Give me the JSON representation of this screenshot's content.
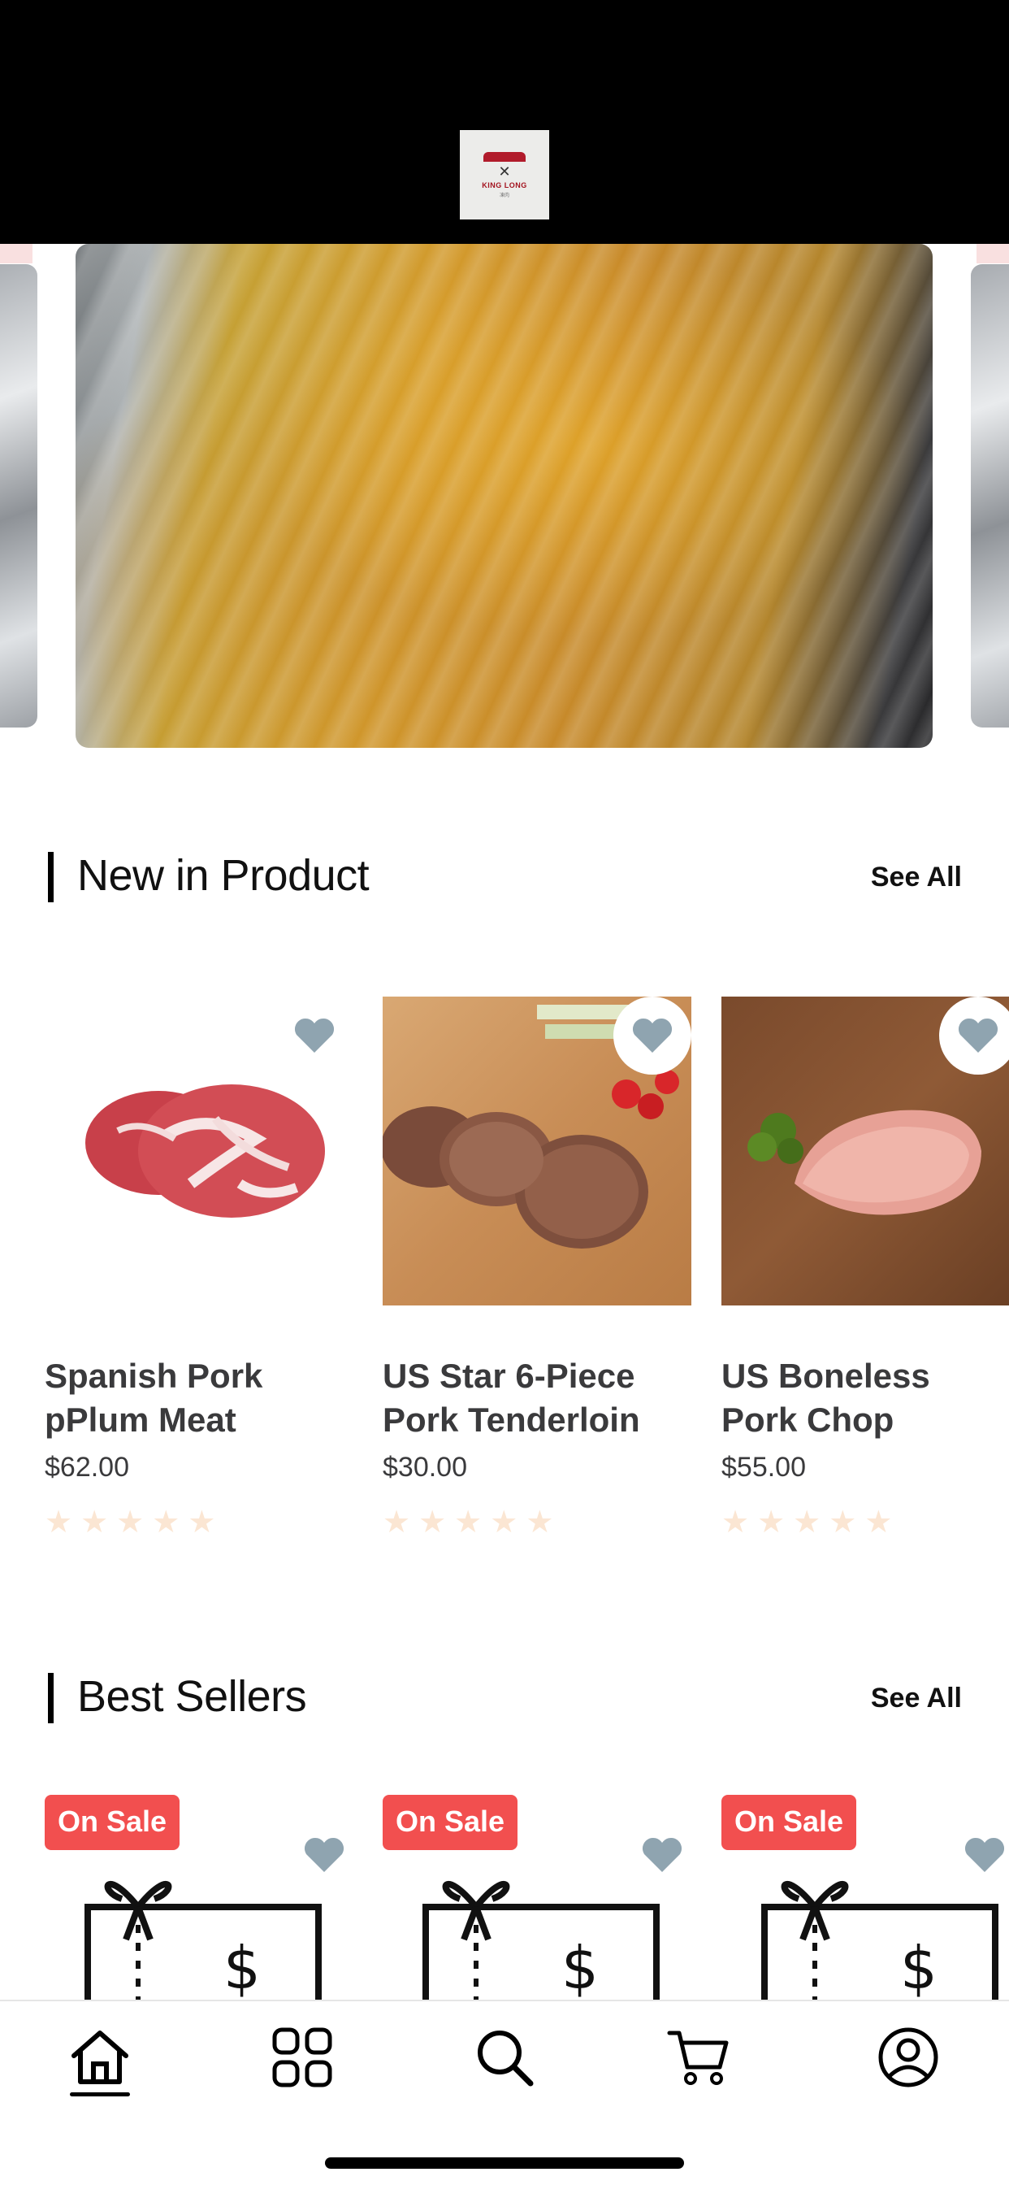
{
  "header": {
    "logo_text": "KING LONG",
    "logo_sub": "凍肉"
  },
  "carousel": {
    "active_slide": 1
  },
  "new_products": {
    "title": "New in Product",
    "see_all": "See All",
    "items": [
      {
        "name": "Spanish Pork pPlum Meat",
        "price": "$62.00",
        "rating": 0
      },
      {
        "name": "US Star 6-Piece Pork Tenderloin",
        "price": "$30.00",
        "rating": 0
      },
      {
        "name": "US Boneless Pork Chop",
        "price": "$55.00",
        "rating": 0
      }
    ]
  },
  "best_sellers": {
    "title": "Best Sellers",
    "see_all": "See All",
    "items": [
      {
        "badge": "On Sale"
      },
      {
        "badge": "On Sale"
      },
      {
        "badge": "On Sale"
      }
    ]
  },
  "bottom_nav": {
    "items": [
      "home-icon",
      "grid-icon",
      "search-icon",
      "cart-icon",
      "profile-icon"
    ],
    "active": "home-icon"
  },
  "colors": {
    "heart": "#8fa4b0",
    "sale_badge": "#f24f4f",
    "star_empty": "#fbe6d3"
  }
}
